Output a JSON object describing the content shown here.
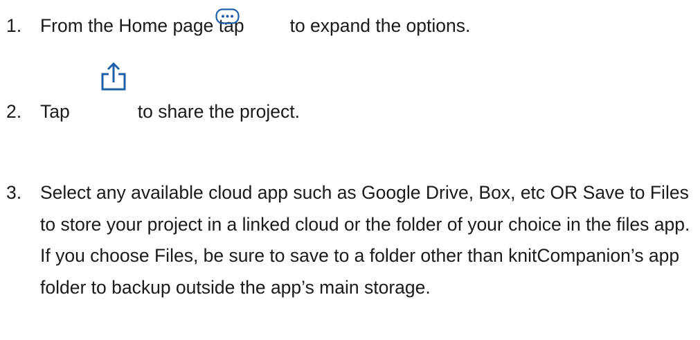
{
  "steps": [
    {
      "number": "1.",
      "text_before": "From the Home page tap",
      "icon": "more-options-icon",
      "text_after": "to expand the options."
    },
    {
      "number": "2.",
      "text_before": "Tap",
      "icon": "share-icon",
      "text_after": "to share the project."
    },
    {
      "number": "3.",
      "text": "Select any available cloud app such as Google Drive, Box, etc OR Save to Files to store your project in a linked cloud or the folder of your choice in the files app. If you choose Files, be sure to save to a folder other than knitCompanion’s app folder to backup outside the app’s main storage."
    }
  ],
  "colors": {
    "text": "#1a1a1a",
    "icon": "#1f5faa"
  }
}
